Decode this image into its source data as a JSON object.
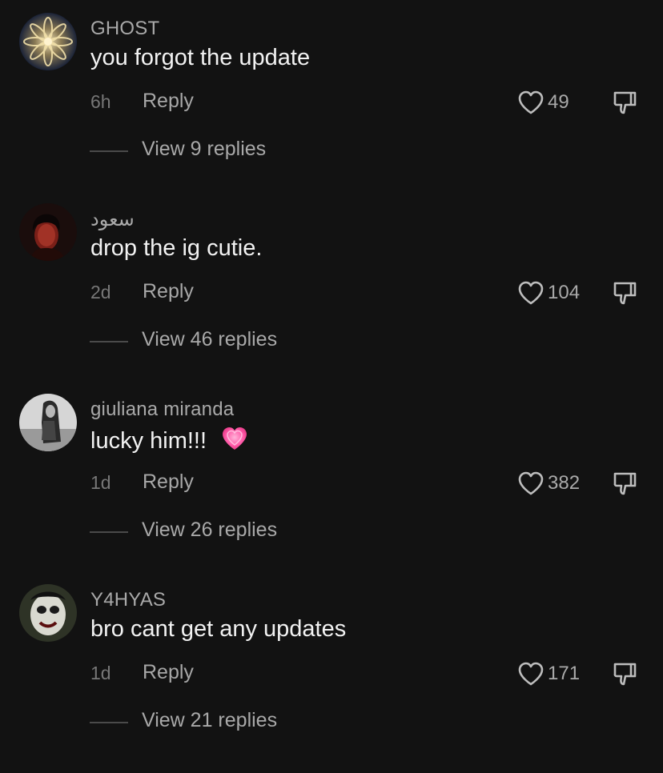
{
  "theme": {
    "background": "#121212",
    "text_primary": "#f2f2f2",
    "text_secondary": "#a9a9a9",
    "text_muted": "#777777"
  },
  "icons": {
    "like": "heart-outline-icon",
    "dislike": "thumbs-down-icon"
  },
  "comments": [
    {
      "username": "GHOST",
      "text": "you forgot the update",
      "emoji": "",
      "time": "6h",
      "reply_label": "Reply",
      "likes": "49",
      "view_replies": "View 9 replies"
    },
    {
      "username": "سعود",
      "text": "drop the ig cutie.",
      "emoji": "",
      "time": "2d",
      "reply_label": "Reply",
      "likes": "104",
      "view_replies": "View 46 replies"
    },
    {
      "username": "giuliana miranda",
      "text": "lucky him!!!",
      "emoji": "pink-heart",
      "time": "1d",
      "reply_label": "Reply",
      "likes": "382",
      "view_replies": "View 26 replies"
    },
    {
      "username": "Y4HYAS",
      "text": "bro cant get any updates",
      "emoji": "",
      "time": "1d",
      "reply_label": "Reply",
      "likes": "171",
      "view_replies": "View 21 replies"
    }
  ]
}
